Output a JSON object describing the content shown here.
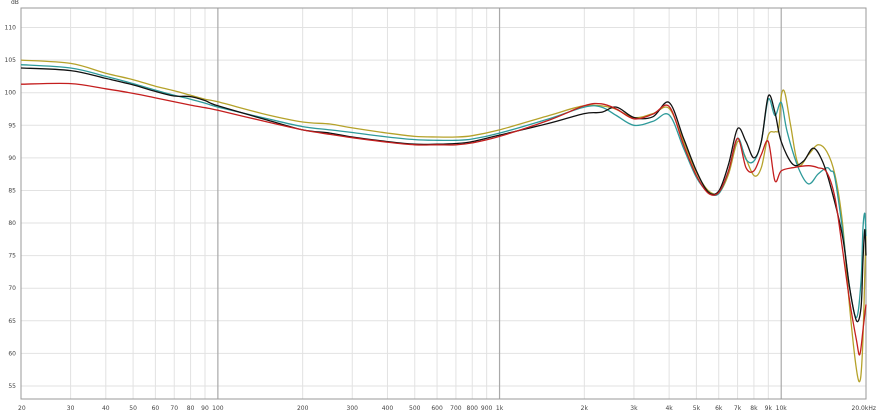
{
  "chart_data": {
    "type": "line",
    "ylabel": "dB",
    "xscale": "log",
    "xlim": [
      20,
      20000
    ],
    "ylim": [
      53,
      113
    ],
    "grid": true,
    "legend": "none",
    "x_ticks": [
      {
        "value": 20,
        "label": "20"
      },
      {
        "value": 30,
        "label": "30"
      },
      {
        "value": 40,
        "label": "40"
      },
      {
        "value": 50,
        "label": "50"
      },
      {
        "value": 60,
        "label": "60"
      },
      {
        "value": 70,
        "label": "70"
      },
      {
        "value": 80,
        "label": "80"
      },
      {
        "value": 90,
        "label": "90"
      },
      {
        "value": 100,
        "label": "100"
      },
      {
        "value": 200,
        "label": "200"
      },
      {
        "value": 300,
        "label": "300"
      },
      {
        "value": 400,
        "label": "400"
      },
      {
        "value": 500,
        "label": "500"
      },
      {
        "value": 600,
        "label": "600"
      },
      {
        "value": 700,
        "label": "700"
      },
      {
        "value": 800,
        "label": "800"
      },
      {
        "value": 900,
        "label": "900"
      },
      {
        "value": 1000,
        "label": "1k"
      },
      {
        "value": 2000,
        "label": "2k"
      },
      {
        "value": 3000,
        "label": "3k"
      },
      {
        "value": 4000,
        "label": "4k"
      },
      {
        "value": 5000,
        "label": "5k"
      },
      {
        "value": 6000,
        "label": "6k"
      },
      {
        "value": 7000,
        "label": "7k"
      },
      {
        "value": 8000,
        "label": "8k"
      },
      {
        "value": 9000,
        "label": "9k"
      },
      {
        "value": 10000,
        "label": "10k"
      },
      {
        "value": 20000,
        "label": "20.0kHz"
      }
    ],
    "y_ticks": [
      55,
      60,
      65,
      70,
      75,
      80,
      85,
      90,
      95,
      100,
      105,
      110
    ],
    "series": [
      {
        "color": "#b5a22a",
        "points": [
          [
            20,
            105.0
          ],
          [
            30,
            104.5
          ],
          [
            40,
            103.0
          ],
          [
            50,
            102.0
          ],
          [
            60,
            101.0
          ],
          [
            70,
            100.3
          ],
          [
            80,
            99.6
          ],
          [
            90,
            99.0
          ],
          [
            100,
            98.6
          ],
          [
            150,
            96.6
          ],
          [
            200,
            95.5
          ],
          [
            250,
            95.2
          ],
          [
            300,
            94.6
          ],
          [
            400,
            93.8
          ],
          [
            500,
            93.3
          ],
          [
            600,
            93.2
          ],
          [
            700,
            93.2
          ],
          [
            800,
            93.4
          ],
          [
            1000,
            94.3
          ],
          [
            1500,
            96.5
          ],
          [
            2000,
            98.0
          ],
          [
            2500,
            97.7
          ],
          [
            3000,
            96.2
          ],
          [
            3500,
            96.8
          ],
          [
            4000,
            97.6
          ],
          [
            4500,
            92.5
          ],
          [
            5000,
            87.8
          ],
          [
            5500,
            85.0
          ],
          [
            6000,
            84.6
          ],
          [
            6500,
            87.5
          ],
          [
            7000,
            92.5
          ],
          [
            7400,
            90.5
          ],
          [
            8000,
            87.3
          ],
          [
            8500,
            88.5
          ],
          [
            9000,
            93.5
          ],
          [
            9500,
            94.0
          ],
          [
            9800,
            94.5
          ],
          [
            10000,
            99.5
          ],
          [
            10300,
            100.0
          ],
          [
            10800,
            95.0
          ],
          [
            11500,
            89.0
          ],
          [
            12500,
            90.5
          ],
          [
            13500,
            92.0
          ],
          [
            14500,
            91.0
          ],
          [
            15500,
            87.5
          ],
          [
            16500,
            80.0
          ],
          [
            17500,
            67.0
          ],
          [
            18500,
            57.5
          ],
          [
            19100,
            56.0
          ],
          [
            19500,
            62.0
          ],
          [
            19800,
            72.0
          ],
          [
            20000,
            79.0
          ]
        ]
      },
      {
        "color": "#2e9a9a",
        "points": [
          [
            20,
            104.3
          ],
          [
            30,
            103.8
          ],
          [
            40,
            102.5
          ],
          [
            50,
            101.4
          ],
          [
            60,
            100.4
          ],
          [
            70,
            99.6
          ],
          [
            80,
            99.0
          ],
          [
            90,
            98.4
          ],
          [
            100,
            97.8
          ],
          [
            150,
            96.0
          ],
          [
            200,
            94.8
          ],
          [
            250,
            94.3
          ],
          [
            300,
            93.9
          ],
          [
            400,
            93.2
          ],
          [
            500,
            92.8
          ],
          [
            600,
            92.7
          ],
          [
            700,
            92.7
          ],
          [
            800,
            92.9
          ],
          [
            1000,
            93.8
          ],
          [
            1500,
            96.0
          ],
          [
            2000,
            97.8
          ],
          [
            2300,
            97.8
          ],
          [
            2600,
            96.5
          ],
          [
            3000,
            95.0
          ],
          [
            3500,
            95.6
          ],
          [
            4000,
            96.6
          ],
          [
            4500,
            91.5
          ],
          [
            5000,
            87.0
          ],
          [
            5500,
            84.8
          ],
          [
            6000,
            84.5
          ],
          [
            6500,
            88.0
          ],
          [
            7000,
            93.0
          ],
          [
            7500,
            89.8
          ],
          [
            8000,
            89.5
          ],
          [
            8500,
            92.5
          ],
          [
            9000,
            99.0
          ],
          [
            9500,
            96.5
          ],
          [
            10000,
            98.5
          ],
          [
            10500,
            94.0
          ],
          [
            11500,
            88.5
          ],
          [
            12500,
            86.0
          ],
          [
            13500,
            87.5
          ],
          [
            14500,
            88.5
          ],
          [
            15000,
            88.0
          ],
          [
            15500,
            87.0
          ],
          [
            16500,
            79.0
          ],
          [
            17500,
            70.0
          ],
          [
            18500,
            65.5
          ],
          [
            19200,
            71.0
          ],
          [
            19500,
            79.0
          ],
          [
            19800,
            81.5
          ],
          [
            20000,
            78.0
          ]
        ]
      },
      {
        "color": "#111111",
        "points": [
          [
            20,
            103.8
          ],
          [
            30,
            103.4
          ],
          [
            40,
            102.2
          ],
          [
            50,
            101.2
          ],
          [
            60,
            100.2
          ],
          [
            70,
            99.5
          ],
          [
            80,
            99.4
          ],
          [
            90,
            98.8
          ],
          [
            100,
            98.0
          ],
          [
            150,
            95.8
          ],
          [
            200,
            94.3
          ],
          [
            250,
            93.8
          ],
          [
            300,
            93.2
          ],
          [
            400,
            92.5
          ],
          [
            500,
            92.1
          ],
          [
            600,
            92.1
          ],
          [
            700,
            92.2
          ],
          [
            800,
            92.5
          ],
          [
            1000,
            93.5
          ],
          [
            1500,
            95.3
          ],
          [
            2000,
            96.8
          ],
          [
            2300,
            97.0
          ],
          [
            2600,
            97.8
          ],
          [
            3000,
            96.2
          ],
          [
            3500,
            96.3
          ],
          [
            4000,
            98.5
          ],
          [
            4500,
            93.0
          ],
          [
            5000,
            88.0
          ],
          [
            5500,
            84.8
          ],
          [
            6000,
            84.9
          ],
          [
            6500,
            89.0
          ],
          [
            7000,
            94.5
          ],
          [
            7500,
            92.5
          ],
          [
            8000,
            90.0
          ],
          [
            8500,
            92.5
          ],
          [
            9000,
            99.5
          ],
          [
            9500,
            97.0
          ],
          [
            10000,
            92.5
          ],
          [
            11000,
            89.0
          ],
          [
            12000,
            89.5
          ],
          [
            13000,
            91.5
          ],
          [
            14000,
            89.5
          ],
          [
            15000,
            85.5
          ],
          [
            16500,
            78.0
          ],
          [
            17500,
            70.0
          ],
          [
            18500,
            65.0
          ],
          [
            19200,
            67.0
          ],
          [
            19500,
            74.0
          ],
          [
            19800,
            79.0
          ],
          [
            20000,
            75.0
          ]
        ]
      },
      {
        "color": "#c41e1e",
        "points": [
          [
            20,
            101.3
          ],
          [
            30,
            101.4
          ],
          [
            40,
            100.6
          ],
          [
            50,
            99.9
          ],
          [
            60,
            99.2
          ],
          [
            70,
            98.6
          ],
          [
            80,
            98.1
          ],
          [
            90,
            97.7
          ],
          [
            100,
            97.3
          ],
          [
            150,
            95.5
          ],
          [
            200,
            94.3
          ],
          [
            250,
            93.6
          ],
          [
            300,
            93.1
          ],
          [
            400,
            92.4
          ],
          [
            500,
            92.0
          ],
          [
            600,
            92.0
          ],
          [
            700,
            92.0
          ],
          [
            800,
            92.3
          ],
          [
            1000,
            93.3
          ],
          [
            1500,
            95.8
          ],
          [
            2000,
            98.0
          ],
          [
            2300,
            98.3
          ],
          [
            2600,
            97.5
          ],
          [
            3000,
            96.0
          ],
          [
            3500,
            96.7
          ],
          [
            4000,
            97.9
          ],
          [
            4500,
            92.0
          ],
          [
            5000,
            87.3
          ],
          [
            5500,
            84.6
          ],
          [
            6000,
            84.7
          ],
          [
            6500,
            88.0
          ],
          [
            7000,
            93.0
          ],
          [
            7500,
            88.5
          ],
          [
            8000,
            88.0
          ],
          [
            8500,
            90.5
          ],
          [
            9000,
            92.5
          ],
          [
            9500,
            86.5
          ],
          [
            10000,
            88.0
          ],
          [
            11000,
            88.5
          ],
          [
            12500,
            88.8
          ],
          [
            13500,
            88.5
          ],
          [
            14500,
            87.8
          ],
          [
            15500,
            84.0
          ],
          [
            16500,
            76.0
          ],
          [
            17500,
            68.0
          ],
          [
            18500,
            62.0
          ],
          [
            19000,
            59.8
          ],
          [
            19500,
            63.5
          ],
          [
            19800,
            66.0
          ],
          [
            20000,
            67.5
          ]
        ]
      }
    ]
  }
}
